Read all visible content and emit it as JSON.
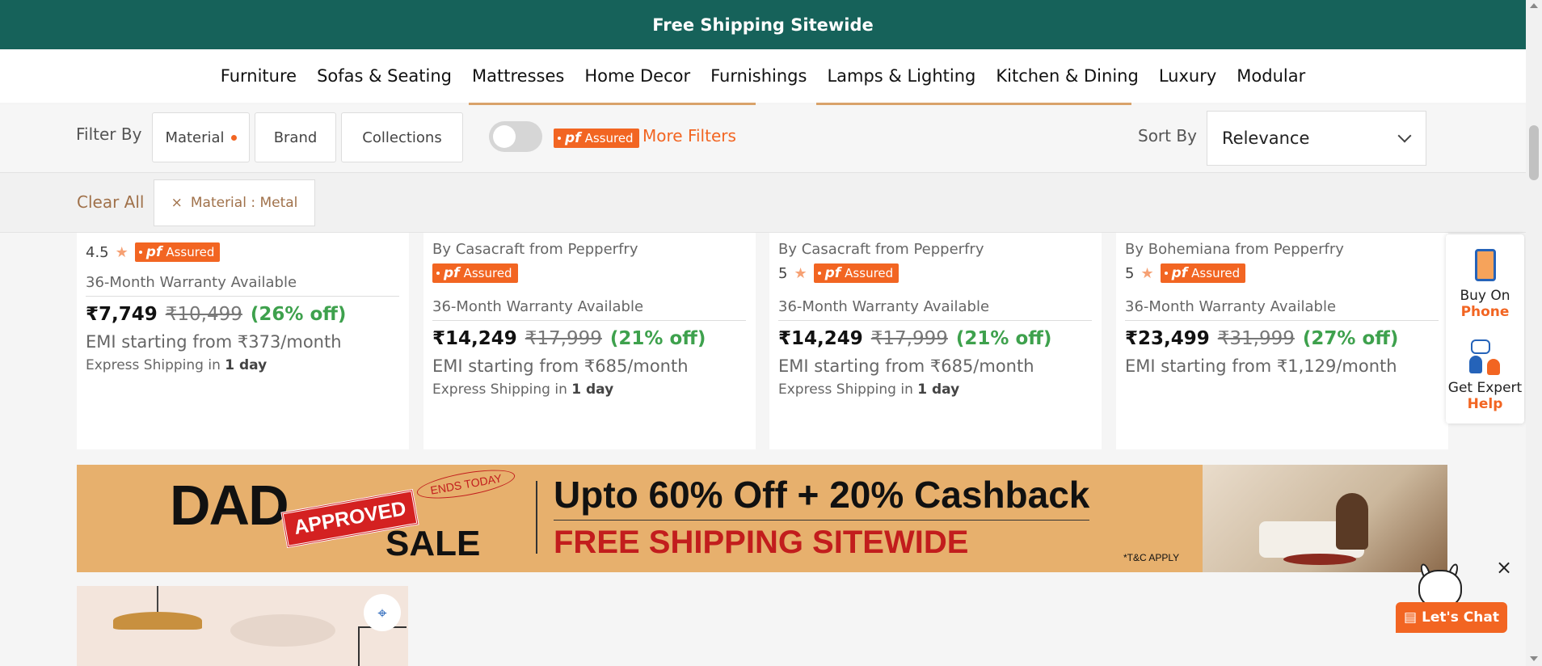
{
  "topbar": {
    "text": "Free Shipping Sitewide",
    "bg_color": "#16625a"
  },
  "nav": {
    "items": [
      "Furniture",
      "Sofas & Seating",
      "Mattresses",
      "Home Decor",
      "Furnishings",
      "Lamps & Lighting",
      "Kitchen & Dining",
      "Luxury",
      "Modular"
    ]
  },
  "filters": {
    "label": "Filter By",
    "material": "Material",
    "brand": "Brand",
    "collections": "Collections",
    "assured_pf": "pf",
    "assured_text": "Assured",
    "more_filters": "More Filters",
    "sort_label": "Sort By",
    "sort_value": "Relevance"
  },
  "chips": {
    "clear_all": "Clear All",
    "active": "Material : Metal",
    "close_icon": "×"
  },
  "products": [
    {
      "brand": "",
      "rating": "4.5",
      "assured": true,
      "warranty": "36-Month Warranty Available",
      "price": "₹7,749",
      "mrp": "₹10,499",
      "off": "(26% off)",
      "emi": "EMI starting from ₹373/month",
      "ship_prefix": "Express Shipping in",
      "ship_days": "1 day"
    },
    {
      "brand": "By Casacraft from Pepperfry",
      "rating": "",
      "assured": true,
      "warranty": "36-Month Warranty Available",
      "price": "₹14,249",
      "mrp": "₹17,999",
      "off": "(21% off)",
      "emi": "EMI starting from ₹685/month",
      "ship_prefix": "Express Shipping in",
      "ship_days": "1 day"
    },
    {
      "brand": "By Casacraft from Pepperfry",
      "rating": "5",
      "assured": true,
      "warranty": "36-Month Warranty Available",
      "price": "₹14,249",
      "mrp": "₹17,999",
      "off": "(21% off)",
      "emi": "EMI starting from ₹685/month",
      "ship_prefix": "Express Shipping in",
      "ship_days": "1 day"
    },
    {
      "brand": "By Bohemiana from Pepperfry",
      "rating": "5",
      "assured": true,
      "warranty": "36-Month Warranty Available",
      "price": "₹23,499",
      "mrp": "₹31,999",
      "off": "(27% off)",
      "emi": "EMI starting from ₹1,129/month",
      "ship_prefix": "",
      "ship_days": ""
    }
  ],
  "banner": {
    "dad": "DAD",
    "approved": "APPROVED",
    "sale": "SALE",
    "ends": "ENDS TODAY",
    "headline": "Upto 60% Off + 20% Cashback",
    "subline": "FREE SHIPPING SITEWIDE",
    "tnc": "*T&C APPLY"
  },
  "side_widget": {
    "buy_on": "Buy On",
    "phone": "Phone",
    "get_expert": "Get Expert",
    "help": "Help"
  },
  "chat": {
    "label": "Let's Chat",
    "close": "×"
  },
  "icons": {
    "star": "★",
    "scan": "⌖",
    "chat_bubble": "▤"
  },
  "colors": {
    "accent": "#f26522",
    "discount": "#3ea14d",
    "clear_all": "#a0714a"
  }
}
